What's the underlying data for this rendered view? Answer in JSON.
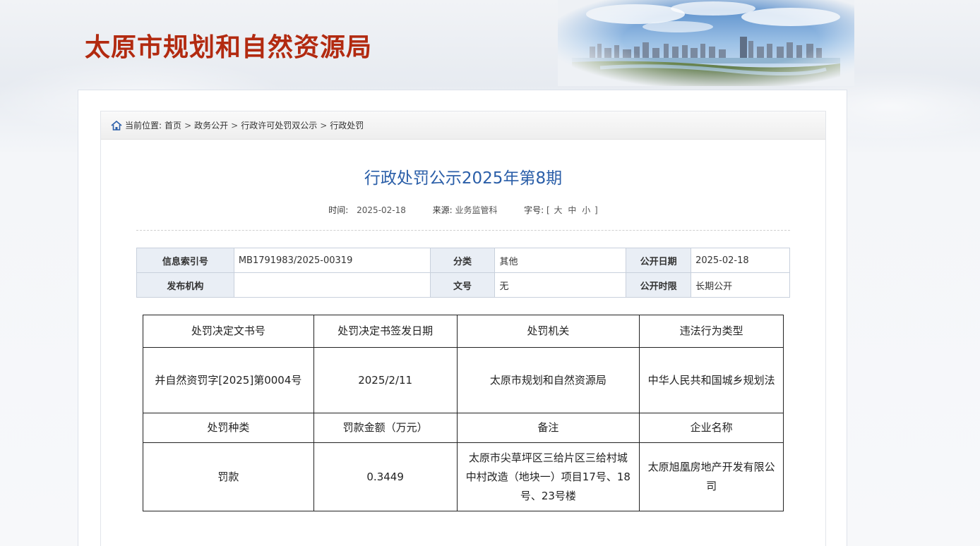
{
  "site": {
    "title": "太原市规划和自然资源局"
  },
  "breadcrumb": {
    "prefix": "当前位置:",
    "items": [
      "首页",
      "政务公开",
      "行政许可处罚双公示",
      "行政处罚"
    ],
    "separator": ">"
  },
  "article": {
    "title": "行政处罚公示2025年第8期",
    "time_label": "时间:",
    "time_value": "2025-02-18",
    "source_label": "来源:",
    "source_value": "业务监管科",
    "fontsize_label": "字号:",
    "fontsize_open": "[",
    "fontsize_options": [
      "大",
      "中",
      "小"
    ],
    "fontsize_close": "]"
  },
  "info": {
    "index_label": "信息索引号",
    "index_value": "MB1791983/2025-00319",
    "category_label": "分类",
    "category_value": "其他",
    "pubdate_label": "公开日期",
    "pubdate_value": "2025-02-18",
    "publisher_label": "发布机构",
    "publisher_value": "",
    "docno_label": "文号",
    "docno_value": "无",
    "duration_label": "公开时限",
    "duration_value": "长期公开"
  },
  "penalty_table": {
    "rows": [
      [
        "处罚决定文书号",
        "处罚决定书签发日期",
        "处罚机关",
        "违法行为类型"
      ],
      [
        "并自然资罚字[2025]第0004号",
        "2025/2/11",
        "太原市规划和自然资源局",
        "中华人民共和国城乡规划法"
      ],
      [
        "处罚种类",
        "罚款金额（万元）",
        "备注",
        "企业名称"
      ],
      [
        "罚款",
        "0.3449",
        "太原市尖草坪区三给片区三给村城中村改造（地块一）项目17号、18号、23号楼",
        "太原旭凰房地产开发有限公司"
      ]
    ]
  },
  "colors": {
    "title_red": "#b22a10",
    "article_blue": "#2a5ea8"
  }
}
